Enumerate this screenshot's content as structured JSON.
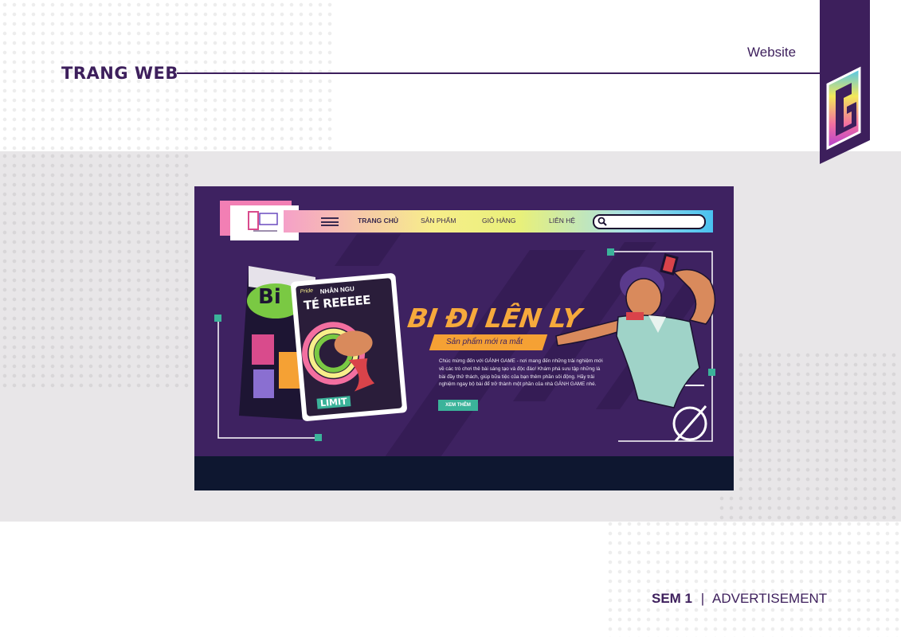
{
  "page": {
    "section_title": "TRANG WEB",
    "category_label": "Website",
    "footer_sem": "SEM 1",
    "footer_separator": "|",
    "footer_label": "ADVERTISEMENT"
  },
  "mockup": {
    "nav": {
      "items": [
        {
          "label": "TRANG CHỦ",
          "active": true
        },
        {
          "label": "SẢN PHẨM",
          "active": false
        },
        {
          "label": "GIỎ HÀNG",
          "active": false
        },
        {
          "label": "LIÊN HỆ",
          "active": false
        }
      ]
    },
    "hero": {
      "headline": "BI ĐI LÊN LY",
      "tagline": "Sản phẩm mới ra mắt",
      "description": "Chúc mừng đến với GÁNH GAME - nơi mang đến những trải nghiệm mới về các trò chơi thẻ bài sáng tạo và độc đáo! Khám phá sưu tập những lá bài đầy thử thách, giúp bữa tiệc của bạn thêm phần sôi động. Hãy trải nghiệm ngay bộ bài để trở thành một phần của nhà GÁNH GAME nhé.",
      "cta_label": "XEM THÊM"
    },
    "product": {
      "box_title": "Bi",
      "card_brand": "Pride",
      "card_title_small": "NHÂN NGU",
      "card_title_big": "TÉ REEEEE",
      "card_footer": "LIMIT"
    }
  },
  "colors": {
    "brand_purple": "#3d1f5c",
    "mock_bg": "#3e2261",
    "mock_footer": "#0e1730",
    "accent_orange": "#f6a93c",
    "accent_teal": "#3bb39a"
  }
}
